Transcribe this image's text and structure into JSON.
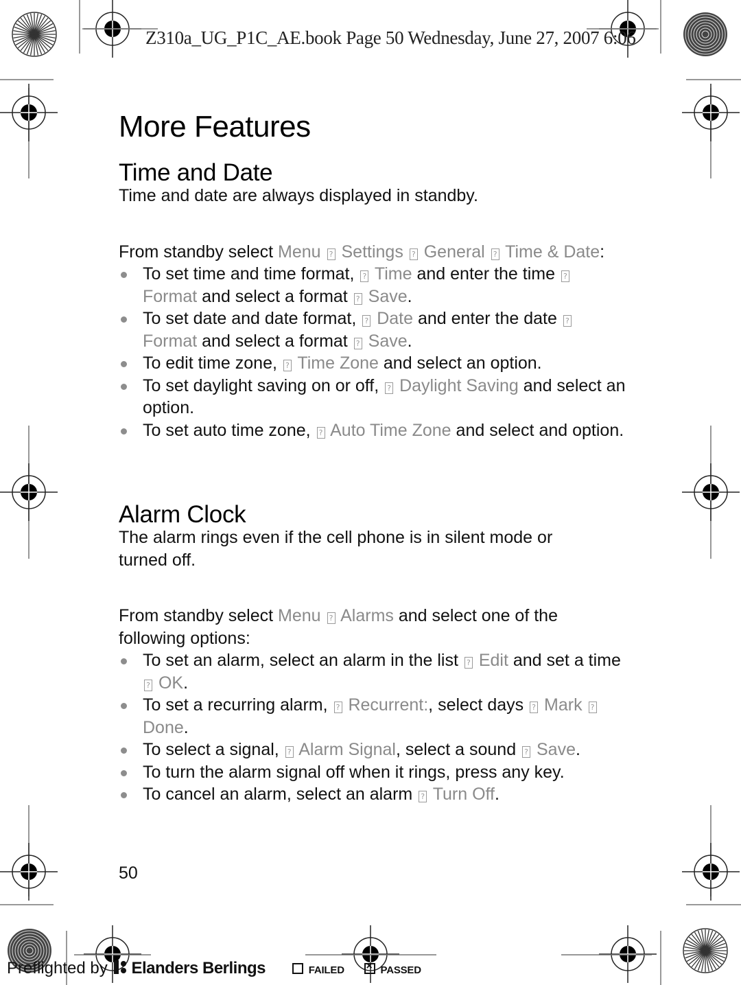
{
  "slug": {
    "text": "Z310a_UG_P1C_AE.book  Page 50  Wednesday, June 27, 2007  6:06"
  },
  "title": "More Features",
  "sections": [
    {
      "heading": "Time and Date",
      "intro": "Time and date are always displayed in standby.",
      "path_prefix": "From standby select ",
      "path_items": [
        "Menu",
        "Settings",
        "General",
        "Time & Date"
      ],
      "path_suffix": ":",
      "bullets": [
        [
          {
            "t": "To set time and time format, "
          },
          {
            "a": "?"
          },
          {
            "u": "Time"
          },
          {
            "t": " and enter the time "
          },
          {
            "a": "?"
          },
          {
            "u": "Format"
          },
          {
            "t": " and select a format "
          },
          {
            "a": "?"
          },
          {
            "u": "Save"
          },
          {
            "t": "."
          }
        ],
        [
          {
            "t": "To set date and date format, "
          },
          {
            "a": "?"
          },
          {
            "u": "Date"
          },
          {
            "t": " and enter the date "
          },
          {
            "a": "?"
          },
          {
            "u": "Format"
          },
          {
            "t": " and select a format "
          },
          {
            "a": "?"
          },
          {
            "u": "Save"
          },
          {
            "t": "."
          }
        ],
        [
          {
            "t": "To edit time zone, "
          },
          {
            "a": "?"
          },
          {
            "u": "Time Zone"
          },
          {
            "t": " and select an option."
          }
        ],
        [
          {
            "t": "To set daylight saving on or off, "
          },
          {
            "a": "?"
          },
          {
            "u": "Daylight Saving"
          },
          {
            "t": " and select an option."
          }
        ],
        [
          {
            "t": "To set auto time zone, "
          },
          {
            "a": "?"
          },
          {
            "u": "Auto Time Zone"
          },
          {
            "t": " and select and option."
          }
        ]
      ]
    },
    {
      "heading": "Alarm Clock",
      "intro": "The alarm rings even if the cell phone is in silent mode or turned off.",
      "path_prefix": "From standby select ",
      "path_items": [
        "Menu",
        "Alarms"
      ],
      "path_suffix": " and select one of the following options:",
      "bullets": [
        [
          {
            "t": "To set an alarm, select an alarm in the list "
          },
          {
            "a": "?"
          },
          {
            "u": "Edit"
          },
          {
            "t": " and set a time "
          },
          {
            "a": "?"
          },
          {
            "u": "OK"
          },
          {
            "t": "."
          }
        ],
        [
          {
            "t": "To set a recurring alarm, "
          },
          {
            "a": "?"
          },
          {
            "u": "Recurrent:"
          },
          {
            "t": ", select days "
          },
          {
            "a": "?"
          },
          {
            "u": "Mark"
          },
          {
            "t": " "
          },
          {
            "a": "?"
          },
          {
            "u": "Done"
          },
          {
            "t": "."
          }
        ],
        [
          {
            "t": "To select a signal, "
          },
          {
            "a": "?"
          },
          {
            "u": "Alarm Signal"
          },
          {
            "t": ", select a sound "
          },
          {
            "a": "?"
          },
          {
            "u": "Save"
          },
          {
            "t": "."
          }
        ],
        [
          {
            "t": "To turn the alarm signal off when it rings, press any key."
          }
        ],
        [
          {
            "t": "To cancel an alarm, select an alarm "
          },
          {
            "a": "?"
          },
          {
            "u": "Turn Off"
          },
          {
            "t": "."
          }
        ]
      ]
    }
  ],
  "page_number": "50",
  "footer": {
    "preflighted_by": "Preflighted by",
    "brand": "Elanders Berlings",
    "failed_label": "FAILED",
    "passed_label": "PASSED",
    "failed_checked": false,
    "passed_checked": true
  },
  "colors": {
    "ui_text": "#8a8a8a",
    "body_text": "#111111",
    "bullet": "#8d8d8d"
  }
}
